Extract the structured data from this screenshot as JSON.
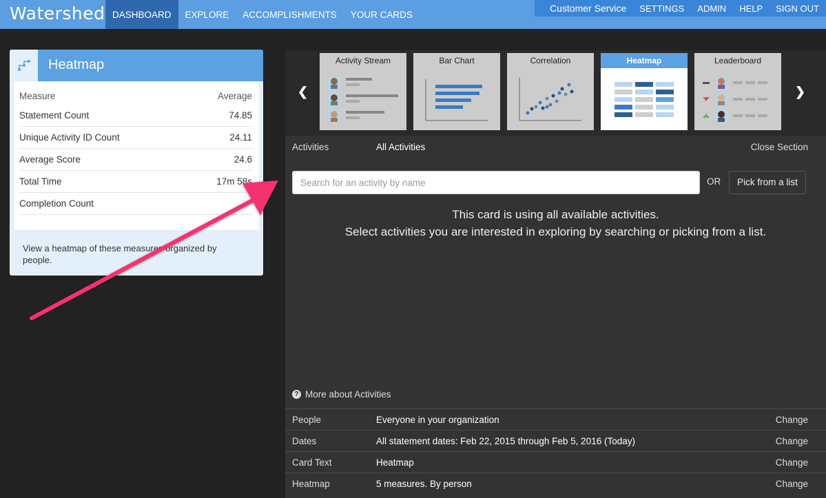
{
  "app": {
    "logo": "Watershed",
    "nav": [
      "DASHBOARD",
      "EXPLORE",
      "ACCOMPLISHMENTS",
      "YOUR CARDS"
    ],
    "utility": [
      "Customer Service",
      "SETTINGS",
      "ADMIN",
      "HELP",
      "SIGN OUT"
    ]
  },
  "card": {
    "title": "Heatmap",
    "measure_header": "Measure",
    "average_header": "Average",
    "rows": [
      {
        "label": "Statement Count",
        "value": "74.85"
      },
      {
        "label": "Unique Activity ID Count",
        "value": "24.11"
      },
      {
        "label": "Average Score",
        "value": "24.6"
      },
      {
        "label": "Total Time",
        "value": "17m 58s"
      },
      {
        "label": "Completion Count",
        "value": ""
      }
    ],
    "description": "View a heatmap of these measures organized by people."
  },
  "carousel": {
    "items": [
      "Activity Stream",
      "Bar Chart",
      "Correlation",
      "Heatmap",
      "Leaderboard"
    ],
    "active": "Heatmap"
  },
  "activities": {
    "label": "Activities",
    "value": "All Activities",
    "close": "Close Section",
    "search_placeholder": "Search for an activity by name",
    "or": "OR",
    "pick_button": "Pick from a list",
    "message_line1": "This card is using all available activities.",
    "message_line2": "Select activities you are interested in exploring by searching or picking from a list.",
    "more": "More about Activities"
  },
  "settings": [
    {
      "key": "People",
      "value": "Everyone in your organization",
      "action": "Change"
    },
    {
      "key": "Dates",
      "value": "All statement dates: Feb 22, 2015 through Feb 5, 2016 (Today)",
      "action": "Change"
    },
    {
      "key": "Card Text",
      "value": "Heatmap",
      "action": "Change"
    },
    {
      "key": "Heatmap",
      "value": "5 measures. By person",
      "action": "Change"
    }
  ],
  "colors": {
    "topbar": "#5b9ee1",
    "nav_active": "#2f69ad",
    "annotation_arrow": "#f5336f"
  }
}
